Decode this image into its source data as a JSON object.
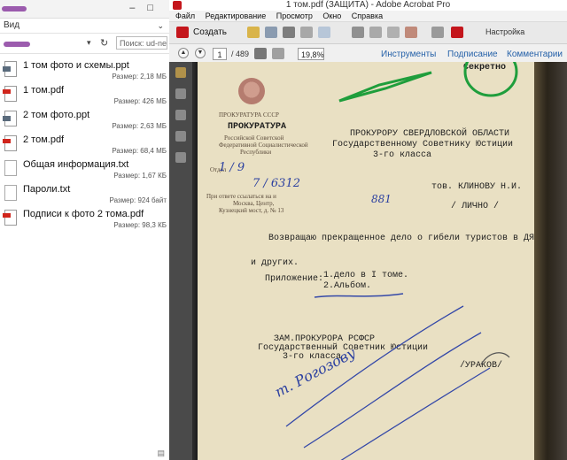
{
  "explorer": {
    "menu": {
      "view_label": "Вид"
    },
    "search": {
      "placeholder": "Поиск: ud-ne..."
    },
    "files": [
      {
        "name": "1 том фото и схемы.ppt",
        "size": "Размер: 2,18 МБ",
        "icon": "ppt-icon"
      },
      {
        "name": "1 том.pdf",
        "size": "Размер: 426 МБ",
        "icon": "pdf-icon"
      },
      {
        "name": "2 том фото.ppt",
        "size": "Размер: 2,63 МБ",
        "icon": "ppt-icon"
      },
      {
        "name": "2 том.pdf",
        "size": "Размер: 68,4 МБ",
        "icon": "pdf-icon"
      },
      {
        "name": "Общая информация.txt",
        "size": "Размер: 1,67 КБ",
        "icon": "txt-icon"
      },
      {
        "name": "Пароли.txt",
        "size": "Размер: 924 байт",
        "icon": "txt-icon"
      },
      {
        "name": "Подписи к фото 2 тома.pdf",
        "size": "Размер: 98,3 КБ",
        "icon": "pdf-icon"
      }
    ]
  },
  "acrobat": {
    "title": "1 том.pdf (ЗАЩИТА) - Adobe Acrobat Pro",
    "menu": [
      "Файл",
      "Редактирование",
      "Просмотр",
      "Окно",
      "Справка"
    ],
    "toolbar": {
      "create_label": "Создать",
      "settings_label": "Настройка"
    },
    "nav": {
      "page_current": "1",
      "page_total": "/ 489",
      "zoom": "19,8%",
      "tools_label": "Инструменты",
      "sign_label": "Подписание",
      "comments_label": "Комментарии"
    },
    "colors": {
      "accent_link": "#2460a8",
      "annotation_green": "#1f9e3c",
      "document_paper": "#e9e0c3"
    }
  },
  "document": {
    "stamp_secret": "Секретно",
    "org_line1": "ПРОКУРАТУРА СССР",
    "org_line2": "ПРОКУРАТУРА",
    "org_line3": "Российской Советской",
    "org_line4": "Федеративной Социалистической",
    "org_line5": "Республики",
    "addressee1": "ПРОКУРОРУ СВЕРДЛОВСКОЙ ОБЛАСТИ",
    "addressee2": "Государственному Советнику Юстиции",
    "addressee3": "3-го класса",
    "addressee4": "тов. КЛИНОВУ Н.И.",
    "personal": "/ ЛИЧНО /",
    "num_label": "Отдел",
    "num_hand1": "1 / 9",
    "num_hand2": "7 / 6312",
    "small_note1": "При ответе ссылаться на и",
    "small_note2": "Москва, Центр,",
    "small_note3": "Кузнецкий мост, д. № 13",
    "hand_num": "881",
    "body1": "Возвращаю прекращенное дело о гибели туристов в ДЯТЛ",
    "body2": "и других.",
    "attach_label": "Приложение:",
    "attach1": "1.дело в I томе.",
    "attach2": "2.Альбом.",
    "sign1": "ЗАМ.ПРОКУРОРА РСФСР",
    "sign2": "Государственный Советник Юстиции",
    "sign3": "3-го класса",
    "sign_name": "/УРАКОВ/",
    "handwritten1": "т. Рогозову"
  }
}
